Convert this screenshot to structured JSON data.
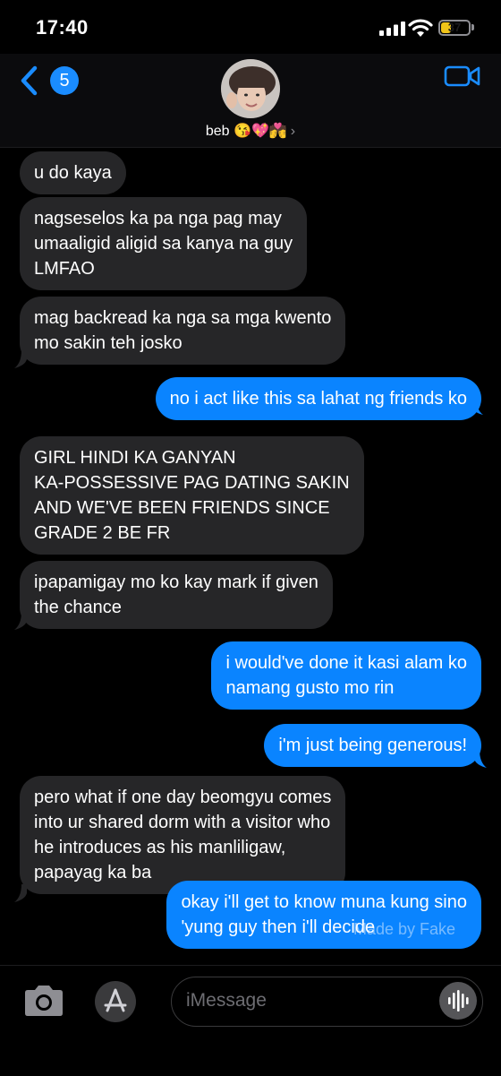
{
  "status_bar": {
    "time": "17:40",
    "battery": "37",
    "battery_level_pct": 37
  },
  "header": {
    "back_count": "5",
    "contact_name": "beb 😘💖💏",
    "chevron": "›"
  },
  "messages": [
    {
      "dir": "in",
      "text": "u do kaya"
    },
    {
      "dir": "in",
      "text": "nagseselos ka pa nga pag may\numaaligid aligid sa kanya na guy\nLMFAO"
    },
    {
      "dir": "in",
      "text": "mag backread ka nga sa mga kwento\nmo sakin teh josko"
    },
    {
      "dir": "out",
      "text": "no i act like this sa lahat ng friends ko"
    },
    {
      "dir": "in",
      "text": "GIRL HINDI KA GANYAN\nKA-POSSESSIVE PAG DATING SAKIN\nAND WE'VE BEEN FRIENDS SINCE\nGRADE 2 BE FR"
    },
    {
      "dir": "in",
      "text": "ipapamigay mo ko kay mark if given\nthe chance"
    },
    {
      "dir": "out",
      "text": "i would've done it kasi alam ko\nnamang gusto mo rin"
    },
    {
      "dir": "out",
      "text": "i'm just being generous!"
    },
    {
      "dir": "in",
      "text": "pero what if one day beomgyu comes\ninto ur shared dorm with a visitor who\nhe introduces as his manliligaw,\npapayag ka ba"
    },
    {
      "dir": "out",
      "text": "okay i'll get to know muna kung sino\n'yung guy then i'll decide"
    }
  ],
  "watermark": "Made by Fake",
  "composer": {
    "placeholder": "iMessage"
  },
  "colors": {
    "incoming": "#262628",
    "outgoing": "#0a84ff",
    "badge": "#1a8cff",
    "background": "#000000"
  },
  "icons": [
    "signal-icon",
    "wifi-icon",
    "battery-icon",
    "back-chevron-icon",
    "video-call-icon",
    "camera-icon",
    "app-store-icon",
    "voice-memo-icon"
  ]
}
